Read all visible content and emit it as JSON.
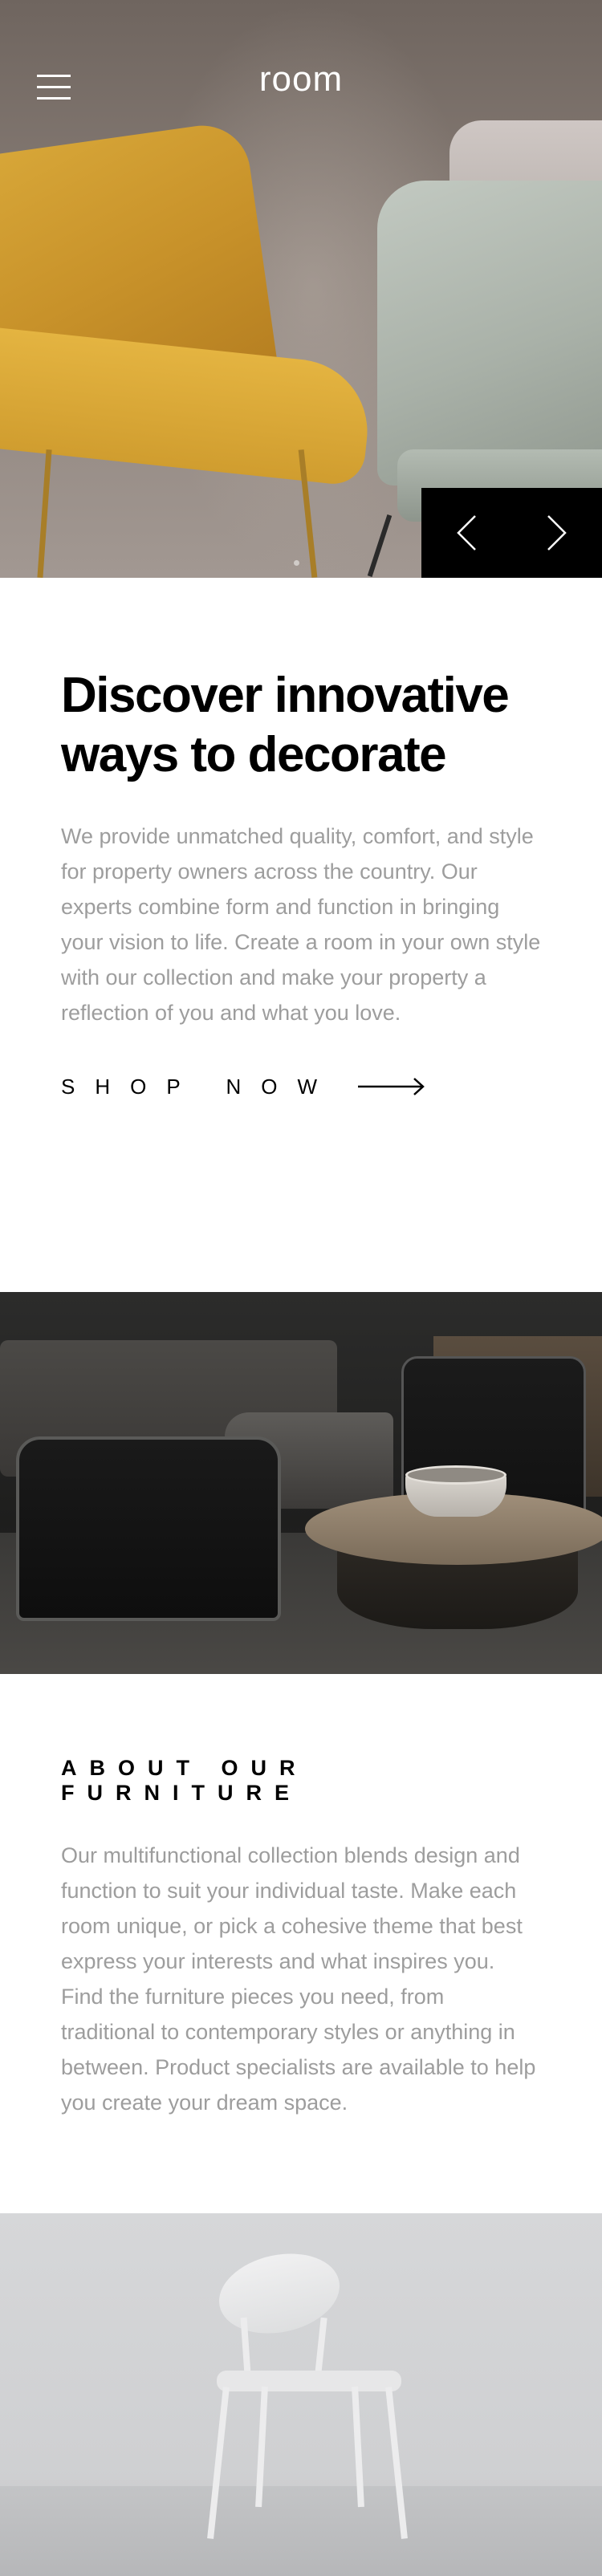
{
  "header": {
    "logo": "room",
    "menu_icon": "hamburger-icon"
  },
  "hero": {
    "prev_icon": "chevron-left-icon",
    "next_icon": "chevron-right-icon"
  },
  "discover": {
    "title": "Discover innovative ways to decorate",
    "body": "We provide unmatched quality, comfort, and style for property owners across the country. Our experts combine form and function in bringing your vision to life. Create a room in your own style with our collection and make your property a reflection of you and what you love.",
    "cta_label": "SHOP NOW",
    "cta_icon": "arrow-right-icon"
  },
  "about": {
    "title": "ABOUT OUR FURNITURE",
    "body": "Our multifunctional collection blends design and function to suit your individual taste. Make each room unique, or pick a cohesive theme that best express your interests and what inspires you. Find the furniture pieces you need, from traditional to contemporary styles or anything in between. Product specialists are available to help you create your dream space."
  },
  "colors": {
    "accent": "#000000",
    "body_text": "#9d9d9d",
    "background": "#ffffff"
  }
}
